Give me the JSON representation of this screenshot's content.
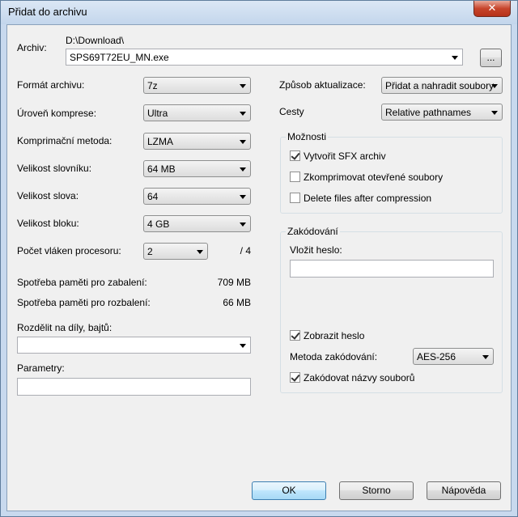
{
  "window": {
    "title": "Přidat do archivu",
    "close_glyph": "✕"
  },
  "archive": {
    "label": "Archiv:",
    "path": "D:\\Download\\",
    "filename": "SPS69T72EU_MN.exe",
    "browse_label": "..."
  },
  "left": {
    "format": {
      "label": "Formát archivu:",
      "value": "7z"
    },
    "level": {
      "label": "Úroveň komprese:",
      "value": "Ultra"
    },
    "method": {
      "label": "Komprimační metoda:",
      "value": "LZMA"
    },
    "dict": {
      "label": "Velikost slovníku:",
      "value": "64 MB"
    },
    "word": {
      "label": "Velikost slova:",
      "value": "64"
    },
    "block": {
      "label": "Velikost bloku:",
      "value": "4 GB"
    },
    "threads": {
      "label": "Počet vláken procesoru:",
      "value": "2",
      "max": "/ 4"
    },
    "mem_pack": {
      "label": "Spotřeba paměti pro zabalení:",
      "value": "709 MB"
    },
    "mem_unpack": {
      "label": "Spotřeba paměti pro rozbalení:",
      "value": "66 MB"
    },
    "split": {
      "label": "Rozdělit na díly, bajtů:",
      "value": ""
    },
    "params": {
      "label": "Parametry:",
      "value": ""
    }
  },
  "right": {
    "update": {
      "label": "Způsob aktualizace:",
      "value": "Přidat a nahradit soubory"
    },
    "paths": {
      "label": "Cesty",
      "value": "Relative pathnames"
    },
    "options": {
      "title": "Možnosti",
      "sfx": {
        "label": "Vytvořit SFX archiv",
        "checked": true
      },
      "open_files": {
        "label": "Zkomprimovat otevřené soubory",
        "checked": false
      },
      "delete": {
        "label": "Delete files after compression",
        "checked": false
      }
    },
    "encryption": {
      "title": "Zakódování",
      "password_label": "Vložit heslo:",
      "password_value": "",
      "show_password": {
        "label": "Zobrazit heslo",
        "checked": true
      },
      "method_label": "Metoda zakódování:",
      "method_value": "AES-256",
      "encrypt_names": {
        "label": "Zakódovat názvy souborů",
        "checked": true
      }
    }
  },
  "buttons": {
    "ok": "OK",
    "cancel": "Storno",
    "help": "Nápověda"
  }
}
